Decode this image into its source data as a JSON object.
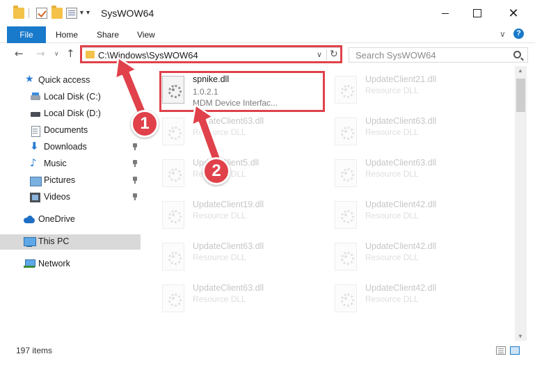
{
  "window": {
    "title": "SysWOW64",
    "close_glyph": "✕"
  },
  "ribbon": {
    "tabs": [
      "File",
      "Home",
      "Share",
      "View"
    ],
    "help": "?"
  },
  "address": {
    "path": "C:\\Windows\\SysWOW64",
    "search_placeholder": "Search SysWOW64"
  },
  "sidebar": {
    "items": [
      {
        "label": "Quick access"
      },
      {
        "label": "Local Disk (C:)"
      },
      {
        "label": "Local Disk (D:)"
      },
      {
        "label": "Documents"
      },
      {
        "label": "Downloads"
      },
      {
        "label": "Music"
      },
      {
        "label": "Pictures"
      },
      {
        "label": "Videos"
      },
      {
        "label": "OneDrive"
      },
      {
        "label": "This PC"
      },
      {
        "label": "Network"
      }
    ]
  },
  "files": {
    "highlighted": {
      "name": "spnike.dll",
      "version": "1.0.2.1",
      "description": "MDM Device Interfac..."
    },
    "column_left": [
      {
        "name": "UpdateClient63.dll",
        "type": "Resource DLL"
      },
      {
        "name": "UpdateClient5.dll",
        "type": "Resource DLL"
      },
      {
        "name": "UpdateClient19.dll",
        "type": "Resource DLL"
      },
      {
        "name": "UpdateClient63.dll",
        "type": "Resource DLL"
      },
      {
        "name": "UpdateClient63.dll",
        "type": "Resource DLL"
      }
    ],
    "column_right": [
      {
        "name": "UpdateClient21.dll",
        "type": "Resource DLL"
      },
      {
        "name": "UpdateClient63.dll",
        "type": "Resource DLL"
      },
      {
        "name": "UpdateClient63.dll",
        "type": "Resource DLL"
      },
      {
        "name": "UpdateClient42.dll",
        "type": "Resource DLL"
      },
      {
        "name": "UpdateClient42.dll",
        "type": "Resource DLL"
      },
      {
        "name": "UpdateClient42.dll",
        "type": "Resource DLL"
      }
    ]
  },
  "status": {
    "item_count": "197 items"
  },
  "annotations": {
    "step1": "1",
    "step2": "2",
    "color": "#e0414a"
  }
}
